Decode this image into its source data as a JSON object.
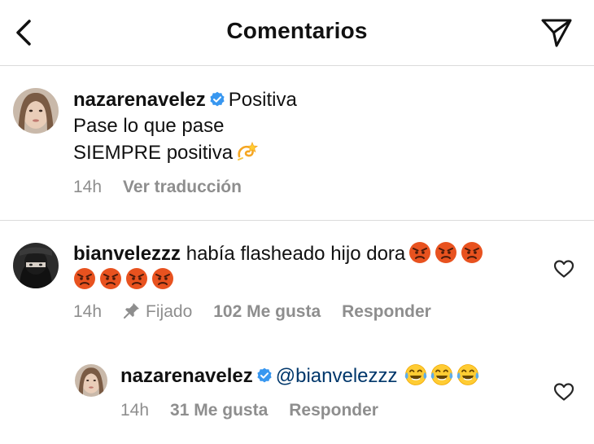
{
  "header": {
    "title": "Comentarios",
    "back_icon": "chevron-left-icon",
    "share_icon": "paper-plane-icon"
  },
  "caption": {
    "username": "nazarenavelez",
    "verified": true,
    "first_line": "Positiva",
    "line2": "Pase lo que pase",
    "line3": "SIEMPRE positiva",
    "emoji": "dizzy-emoji",
    "time": "14h",
    "translate": "Ver traducción"
  },
  "comments": [
    {
      "username": "bianvelezzz",
      "text": "había flasheado hijo dora",
      "emoji": "angry-face-emoji",
      "emoji_count": 7,
      "time": "14h",
      "pinned_label": "Fijado",
      "likes": "102 Me gusta",
      "reply": "Responder"
    },
    {
      "username": "nazarenavelez",
      "verified": true,
      "mention": "@bianvelezzz",
      "emoji": "laughing-tears-emoji",
      "emoji_count": 3,
      "time": "14h",
      "likes": "31 Me gusta",
      "reply": "Responder"
    }
  ],
  "colors": {
    "text": "#111111",
    "muted": "#8e8e8e",
    "mention": "#00376b",
    "verified": "#3897f0",
    "divider": "#dbdbdb"
  }
}
